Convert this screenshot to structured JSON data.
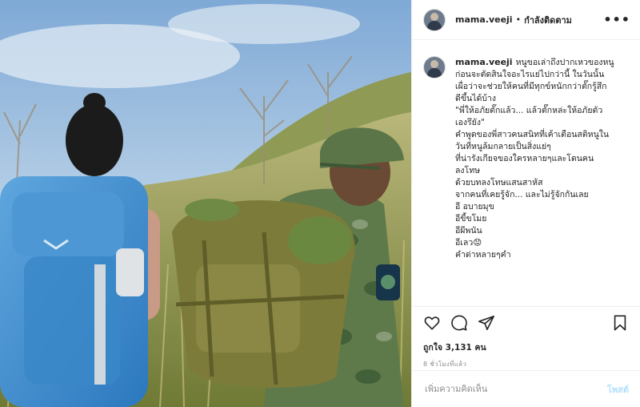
{
  "post": {
    "username": "mama.veeji",
    "separator": "•",
    "follow_label": "กำลังติดตาม",
    "more_label": "•••",
    "caption_username": "mama.veeji",
    "caption_lines": [
      "หนูขอเล่าถึงปากเหวของหนู",
      "ก่อนจะตัดสินใจอะไรแย่ไปกว่านี้ ในวันนั้น",
      "เผื่อว่าจะช่วยให้คนที่มีทุกข์หนักกว่าตั๊กรู้สึก",
      "ดีขึ้นได้บ้าง",
      "",
      "\"พี่ให้อภัยตั๊กแล้ว... แล้วตั๊กหล่ะให้อภัยตัว",
      "เองรึยัง\"",
      "",
      "คำพูดของพี่สาวคนสนิทที่เค้าเตือนสติหนูใน",
      "วันที่หนูล้มกลายเป็นสิ่งแย่ๆ",
      "ที่น่ารังเกียจของใครหลายๆและโดนคน",
      "ลงโทษ",
      "ด้วยบทลงโทษแสนสาหัส",
      "จากคนที่เคยรู้จัก... และไม่รู้จักกันเลย",
      "อี อบายมุข",
      "อีขี้ขโมย",
      "อีผีพนัน",
      "อีเลว😟",
      "",
      "คำด่าหลายๆคำ"
    ],
    "likes": "ถูกใจ 3,131 คน",
    "time": "8 ชั่วโมงที่แล้ว",
    "comment_placeholder": "เพิ่มความคิดเห็น",
    "post_button": "โพสต์"
  },
  "icons": {
    "like": "heart-icon",
    "comment": "comment-icon",
    "share": "share-icon",
    "save": "bookmark-icon"
  },
  "colors": {
    "post_button": "#b2dffc",
    "secondary_text": "#8e8e8e",
    "divider": "#efefef"
  }
}
